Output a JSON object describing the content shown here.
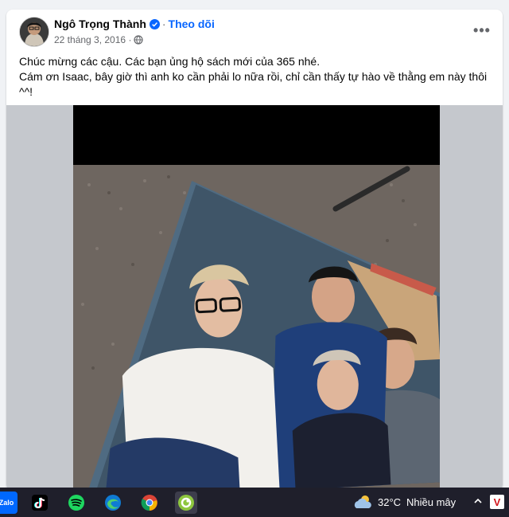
{
  "post": {
    "author": "Ngô Trọng Thành",
    "follow_label": "Theo dõi",
    "separator": "·",
    "date": "22 tháng 3, 2016",
    "meta_separator": "·",
    "more_label": "•••",
    "text_lines": [
      "Chúc mừng các cậu. Các bạn ủng hộ sách mới của 365 nhé.",
      "Cám ơn Isaac, bây giờ thì anh ko cần phải lo nữa rồi, chỉ cần thấy tự hào về thằng em này thôi",
      "^^!"
    ],
    "verified_icon": "verified-badge-icon",
    "privacy_icon": "globe-icon",
    "image_description_icon": "post-photo"
  },
  "taskbar": {
    "apps": [
      {
        "name": "zalo",
        "label": "Zalo"
      },
      {
        "name": "tiktok",
        "label": ""
      },
      {
        "name": "spotify",
        "label": ""
      },
      {
        "name": "edge",
        "label": ""
      },
      {
        "name": "chrome",
        "label": ""
      },
      {
        "name": "coccoc",
        "label": ""
      }
    ],
    "weather": {
      "temperature": "32°C",
      "condition": "Nhiều mây",
      "icon": "partly-cloudy-icon"
    },
    "tray_chevron_icon": "chevron-up-icon",
    "antivirus_label": "V"
  },
  "colors": {
    "brand_blue": "#0866ff",
    "taskbar_bg": "#1f1f2b",
    "page_bg": "#f0f2f5"
  }
}
